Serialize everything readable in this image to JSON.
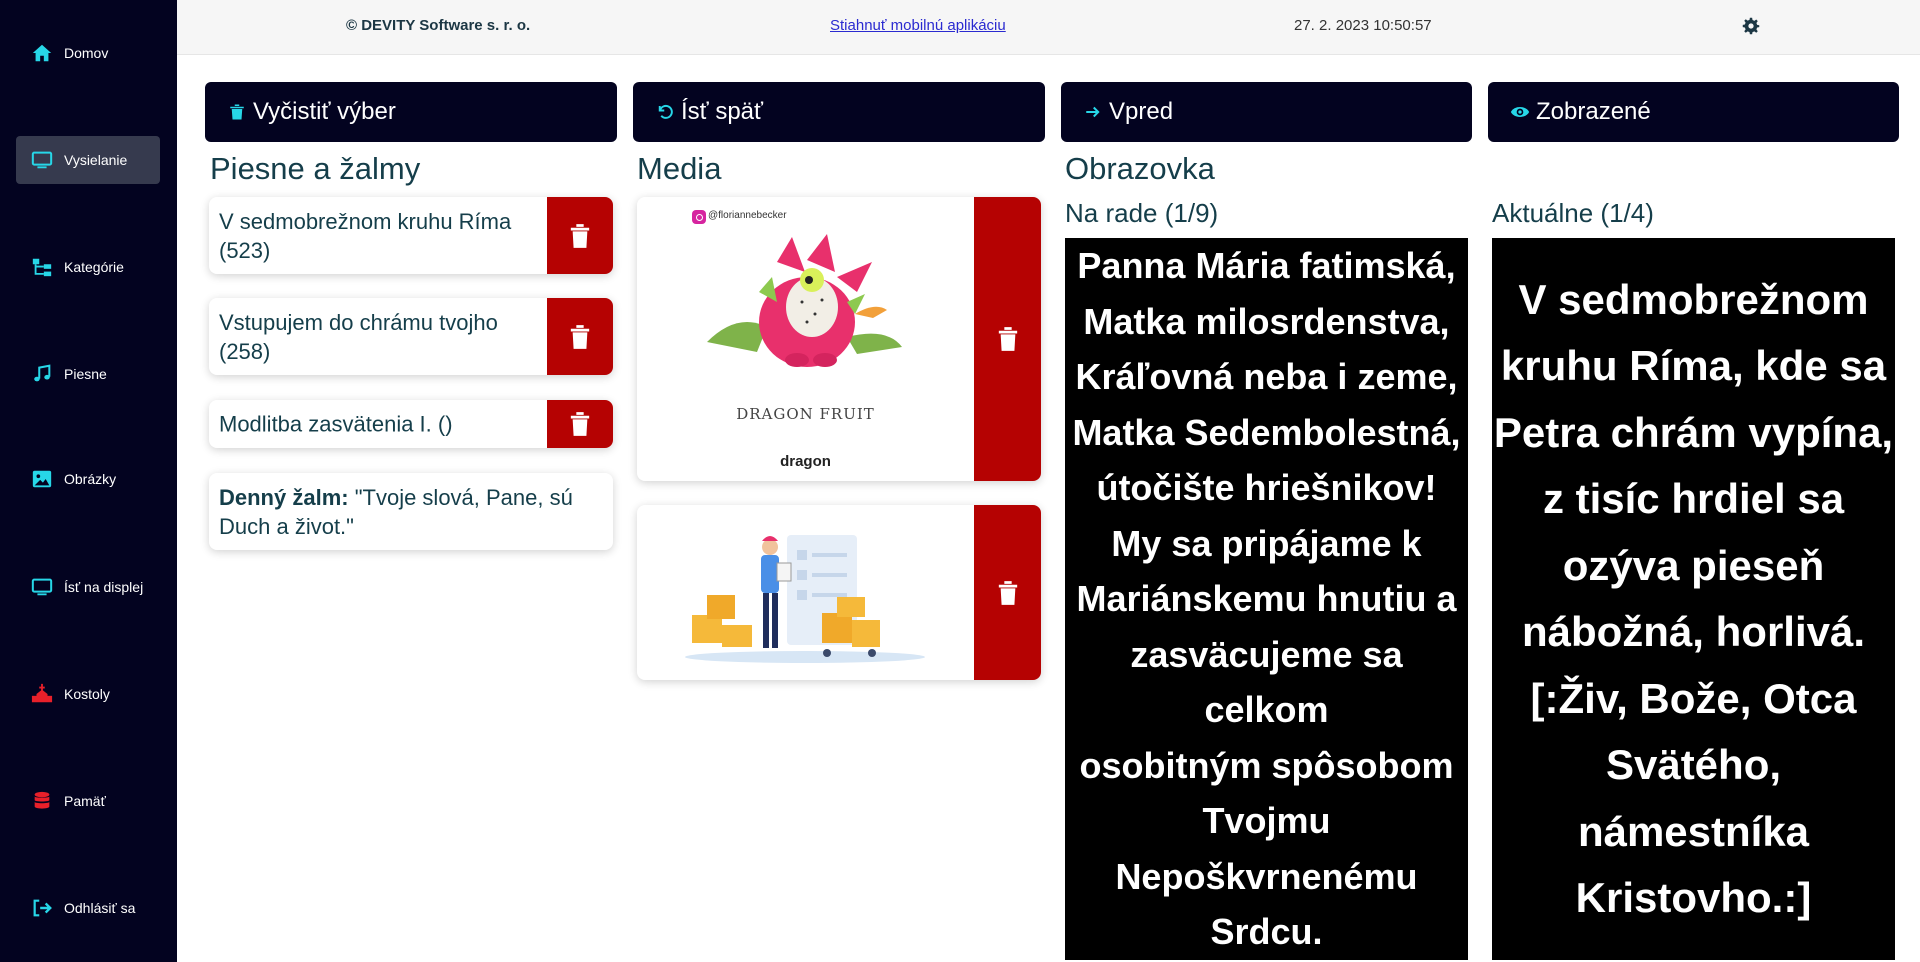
{
  "sidebar": {
    "items": [
      {
        "label": "Domov",
        "icon": "home-icon",
        "color": "#27d7e8"
      },
      {
        "label": "Vysielanie",
        "icon": "monitor-icon",
        "color": "#27d7e8",
        "active": true
      },
      {
        "label": "Kategórie",
        "icon": "sitemap-icon",
        "color": "#27d7e8"
      },
      {
        "label": "Piesne",
        "icon": "music-icon",
        "color": "#27d7e8"
      },
      {
        "label": "Obrázky",
        "icon": "image-icon",
        "color": "#27d7e8"
      },
      {
        "label": "Ísť na displej",
        "icon": "monitor-icon",
        "color": "#27d7e8"
      },
      {
        "label": "Kostoly",
        "icon": "church-icon",
        "color": "#e8202a"
      },
      {
        "label": "Pamäť",
        "icon": "database-icon",
        "color": "#e8202a"
      },
      {
        "label": "Odhlásiť sa",
        "icon": "logout-icon",
        "color": "#27d7e8"
      }
    ]
  },
  "topbar": {
    "copyright": "© DEVITY Software s. r. o.",
    "app_link": "Stiahnuť mobilnú aplikáciu",
    "datetime": "27. 2. 2023 10:50:57",
    "settings_icon": "gear-icon"
  },
  "actions": {
    "clear": {
      "label": "Vyčistiť výber",
      "icon": "trash-icon"
    },
    "back": {
      "label": "Ísť späť",
      "icon": "undo-icon"
    },
    "forward": {
      "label": "Vpred",
      "icon": "arrow-right-icon"
    },
    "shown": {
      "label": "Zobrazené",
      "icon": "eye-icon"
    }
  },
  "songs": {
    "title": "Piesne a žalmy",
    "items": [
      {
        "label": "V sedmobrežnom kruhu Ríma (523)"
      },
      {
        "label": "Vstupujem do chrámu tvojho (258)"
      },
      {
        "label": "Modlitba zasvätenia I. ()"
      }
    ],
    "psalm_label": "Denný žalm:",
    "psalm_text": " \"Tvoje slová, Pane, sú Duch a život.\""
  },
  "media": {
    "title": "Media",
    "items": [
      {
        "caption": "dragon",
        "instagram": "@floriannebecker",
        "art_text": "DRAGON FRUIT"
      },
      {
        "caption": ""
      }
    ]
  },
  "screen": {
    "title": "Obrazovka",
    "next_label": "Na rade (1/9)",
    "current_label": "Aktuálne (1/4)",
    "next_text": "Panna Mária fatimská,\nMatka milosrdenstva,\nKráľovná neba i zeme,\nMatka Sedembolestná,\nútočište hriešnikov!\nMy sa pripájame k\nMariánskemu hnutiu a\nzasväcujeme sa celkom\nosobitným spôsobom\nTvojmu\nNepoškvrnenému Srdcu.",
    "current_text": "V sedmobrežnom\nkruhu Ríma, kde sa\nPetra chrám vypína,\nz tisíc hrdiel sa\nozýva pieseň\nnábožná, horlivá.\n[:Živ, Bože, Otca\nSvätého,\nnámestníka\nKristovho.:]"
  },
  "colors": {
    "sidebar_bg": "#030320",
    "accent": "#27d7e8",
    "delete": "#b50202",
    "text": "#153e4a"
  }
}
